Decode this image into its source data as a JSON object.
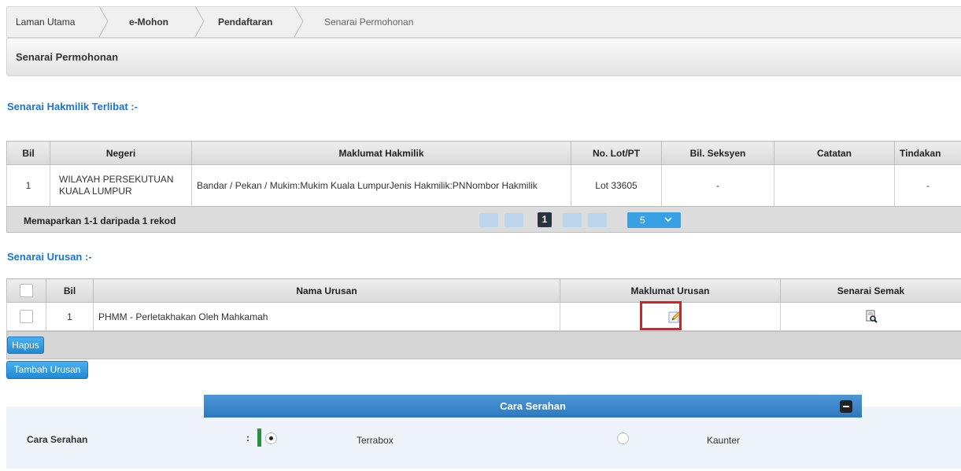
{
  "breadcrumb": [
    "Laman Utama",
    "e-Mohon",
    "Pendaftaran",
    "Senarai Permohonan"
  ],
  "page_title": "Senarai Permohonan",
  "hakmilik": {
    "heading": "Senarai Hakmilik Terlibat :-",
    "headers": [
      "Bil",
      "Negeri",
      "Maklumat Hakmilik",
      "No. Lot/PT",
      "Bil. Seksyen",
      "Catatan",
      "Tindakan"
    ],
    "row": {
      "bil": "1",
      "negeri": "WILAYAH PERSEKUTUAN KUALA LUMPUR",
      "maklumat": "Bandar / Pekan / Mukim:Mukim Kuala LumpurJenis Hakmilik:PNNombor Hakmilik",
      "lot": "Lot 33605",
      "seksyen": "-",
      "catatan": "",
      "tindakan": "-"
    },
    "pager_info": "Memaparkan 1-1 daripada 1 rekod",
    "current_page": "1",
    "page_size": "5"
  },
  "urusan": {
    "heading": "Senarai Urusan :-",
    "headers": [
      "Bil",
      "Nama Urusan",
      "Maklumat Urusan",
      "Senarai Semak"
    ],
    "row": {
      "bil": "1",
      "nama": "PHMM - Perletakhakan Oleh Mahkamah"
    },
    "delete_label": "Hapus",
    "add_label": "Tambah Urusan"
  },
  "serahan": {
    "title": "Cara Serahan",
    "label": "Cara Serahan",
    "colon": ":",
    "options": [
      "Terrabox",
      "Kaunter"
    ]
  }
}
